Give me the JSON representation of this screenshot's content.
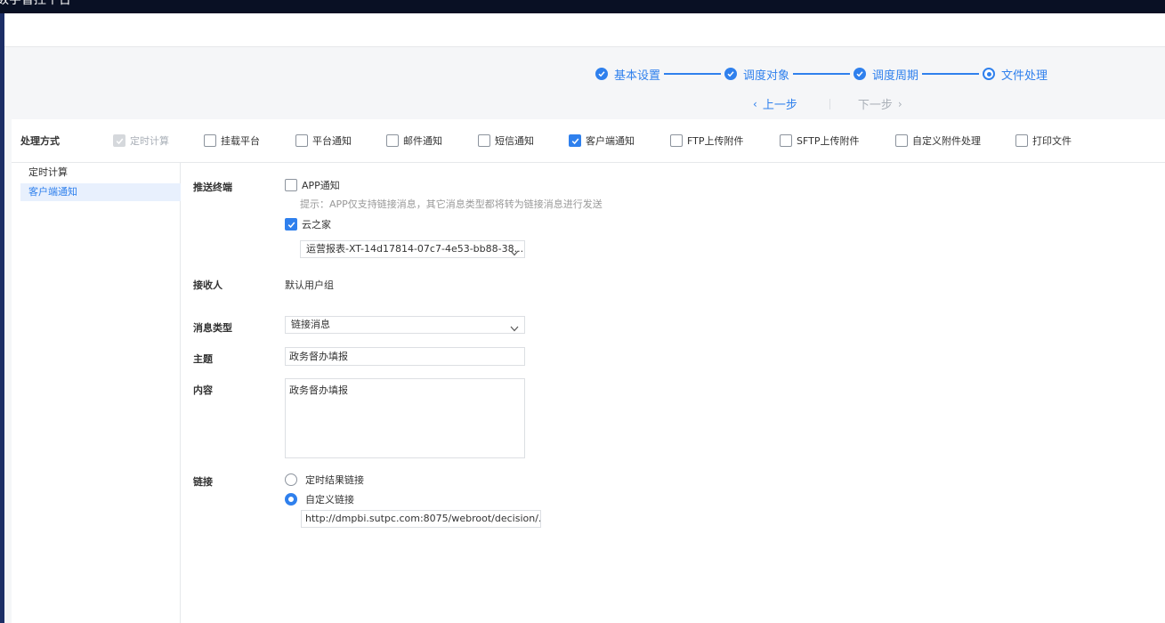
{
  "app": {
    "title": "数字督控平台"
  },
  "steps": [
    {
      "label": "基本设置",
      "state": "done"
    },
    {
      "label": "调度对象",
      "state": "done"
    },
    {
      "label": "调度周期",
      "state": "done"
    },
    {
      "label": "文件处理",
      "state": "current"
    }
  ],
  "nav": {
    "prev_label": "上一步",
    "next_label": "下一步"
  },
  "methods": {
    "label": "处理方式",
    "items": [
      {
        "label": "定时计算",
        "checked": true,
        "disabled": true
      },
      {
        "label": "挂载平台",
        "checked": false
      },
      {
        "label": "平台通知",
        "checked": false
      },
      {
        "label": "邮件通知",
        "checked": false
      },
      {
        "label": "短信通知",
        "checked": false
      },
      {
        "label": "客户端通知",
        "checked": true
      },
      {
        "label": "FTP上传附件",
        "checked": false
      },
      {
        "label": "SFTP上传附件",
        "checked": false
      },
      {
        "label": "自定义附件处理",
        "checked": false
      },
      {
        "label": "打印文件",
        "checked": false
      }
    ]
  },
  "sidebar": {
    "items": [
      {
        "label": "定时计算",
        "active": false
      },
      {
        "label": "客户端通知",
        "active": true
      }
    ]
  },
  "form": {
    "push_terminal": {
      "label": "推送终端",
      "app_label": "APP通知",
      "app_checked": false,
      "hint": "提示：APP仅支持链接消息，其它消息类型都将转为链接消息进行发送",
      "yun_label": "云之家",
      "yun_checked": true,
      "yun_select_value": "运营报表-XT-14d17814-07c7-4e53-bb88-38..."
    },
    "receiver": {
      "label": "接收人",
      "value": "默认用户组"
    },
    "message_type": {
      "label": "消息类型",
      "value": "链接消息"
    },
    "subject": {
      "label": "主题",
      "value": "政务督办填报"
    },
    "content": {
      "label": "内容",
      "value": "政务督办填报"
    },
    "link": {
      "label": "链接",
      "option_1": "定时结果链接",
      "option_2": "自定义链接",
      "selected": "自定义链接",
      "custom_url": "http://dmpbi.sutpc.com:8075/webroot/decision/..."
    }
  },
  "colors": {
    "accent": "#2f80ed",
    "titlebar": "#091024"
  }
}
